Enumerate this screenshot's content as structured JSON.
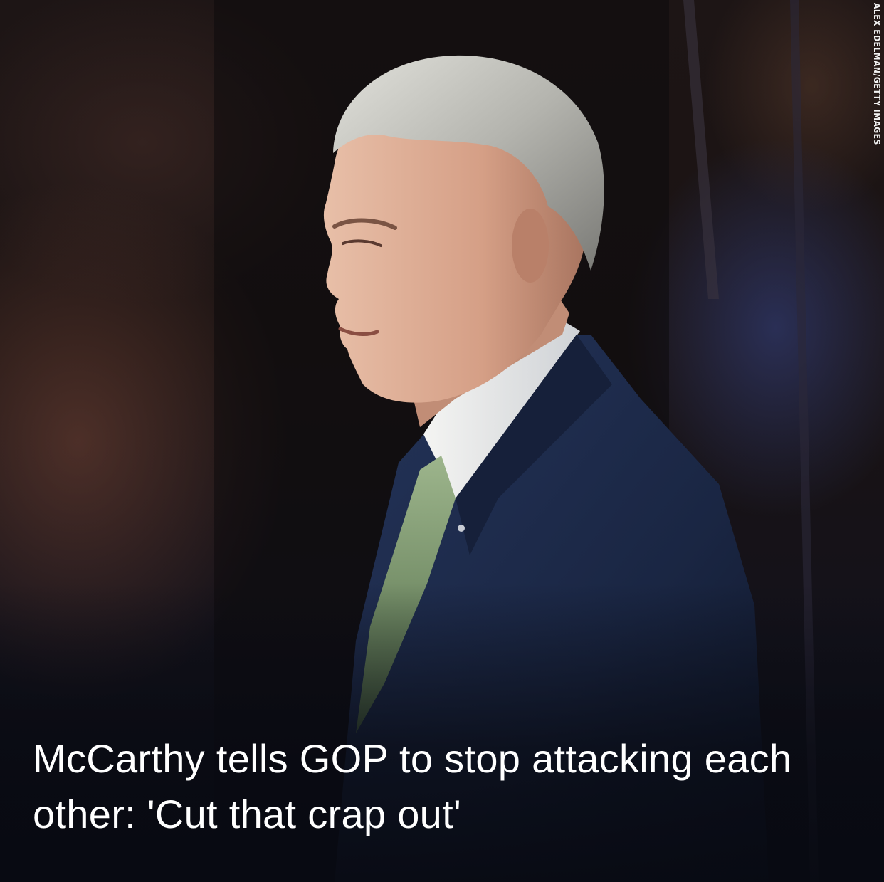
{
  "headline": "McCarthy tells GOP to stop attacking each other: 'Cut that crap out'",
  "photo_credit": "ALEX EDELMAN/GETTY IMAGES",
  "photo": {
    "subject": "speaker-in-profile",
    "icon": "person-portrait-illustration"
  },
  "colors": {
    "headline_text": "#ffffff",
    "background_dark": "#0b0d14",
    "suit_navy": "#1c2a4a",
    "tie_green": "#7a9a6a",
    "hair_gray": "#b9b9b4"
  }
}
